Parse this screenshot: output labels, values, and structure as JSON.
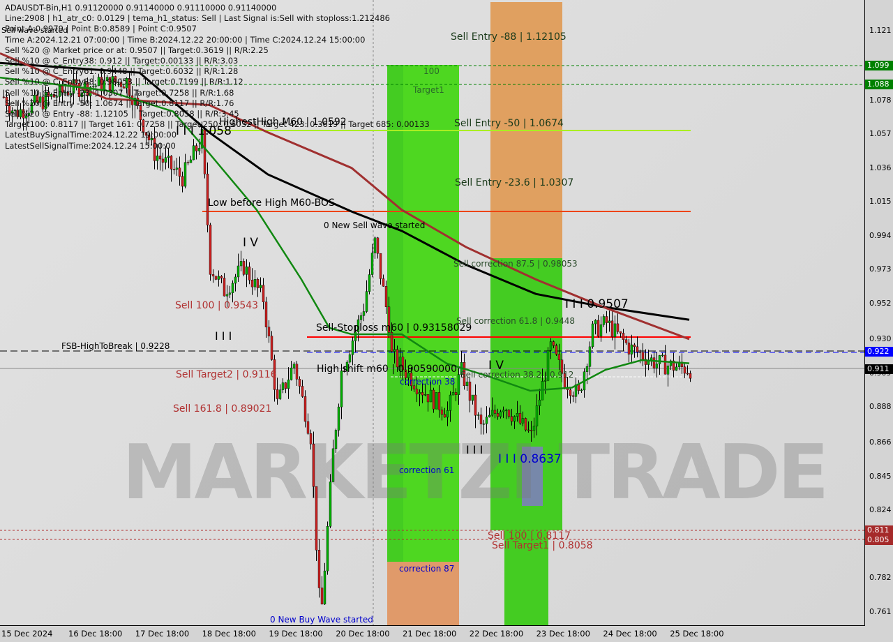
{
  "chart_data": {
    "type": "candlestick",
    "title": "ADAUSDT-Bin,H1  0.91120000 0.91140000 0.91110000 0.91140000",
    "symbol": "ADAUSDT-Bin",
    "timeframe": "H1",
    "ylim": [
      0.755,
      1.13
    ],
    "y_ticks": [
      "1.121",
      "1.078",
      "1.057",
      "1.036",
      "1.015",
      "0.994",
      "0.973",
      "0.952",
      "0.930",
      "0.909",
      "0.888",
      "0.866",
      "0.845",
      "0.824",
      "0.782",
      "0.761"
    ],
    "x_ticks": [
      "15 Dec 2024",
      "16 Dec 18:00",
      "17 Dec 18:00",
      "18 Dec 18:00",
      "19 Dec 18:00",
      "20 Dec 18:00",
      "21 Dec 18:00",
      "22 Dec 18:00",
      "23 Dec 18:00",
      "24 Dec 18:00",
      "25 Dec 18:00"
    ],
    "close": [
      [
        "2024-12-15 09:00",
        1.08
      ],
      [
        "2024-12-15 13:00",
        1.07
      ],
      [
        "2024-12-16 09:00",
        1.085
      ],
      [
        "2024-12-17 05:00",
        1.09
      ],
      [
        "2024-12-17 15:00",
        1.045
      ],
      [
        "2024-12-18 01:00",
        1.03
      ],
      [
        "2024-12-18 08:00",
        1.055
      ],
      [
        "2024-12-18 11:00",
        0.975
      ],
      [
        "2024-12-18 16:00",
        0.96
      ],
      [
        "2024-12-18 23:00",
        0.975
      ],
      [
        "2024-12-19 06:00",
        0.955
      ],
      [
        "2024-12-19 11:00",
        0.89
      ],
      [
        "2024-12-19 17:00",
        0.915
      ],
      [
        "2024-12-19 23:00",
        0.87
      ],
      [
        "2024-12-20 02:00",
        0.77
      ],
      [
        "2024-12-20 03:00",
        0.765
      ],
      [
        "2024-12-20 07:00",
        0.86
      ],
      [
        "2024-12-20 10:00",
        0.91
      ],
      [
        "2024-12-20 18:00",
        0.95
      ],
      [
        "2024-12-20 22:00",
        0.99
      ],
      [
        "2024-12-21 03:00",
        0.94
      ],
      [
        "2024-12-21 04:00",
        0.92
      ],
      [
        "2024-12-21 14:00",
        0.9
      ],
      [
        "2024-12-22 00:00",
        0.885
      ],
      [
        "2024-12-22 05:00",
        0.91
      ],
      [
        "2024-12-22 12:00",
        0.875
      ],
      [
        "2024-12-22 20:00",
        0.89
      ],
      [
        "2024-12-23 06:00",
        0.87
      ],
      [
        "2024-12-23 13:00",
        0.925
      ],
      [
        "2024-12-23 18:00",
        0.905
      ],
      [
        "2024-12-23 23:00",
        0.895
      ],
      [
        "2024-12-24 04:00",
        0.935
      ],
      [
        "2024-12-24 09:00",
        0.94
      ],
      [
        "2024-12-24 17:00",
        0.925
      ],
      [
        "2024-12-25 03:00",
        0.915
      ],
      [
        "2024-12-25 15:00",
        0.9114
      ]
    ],
    "ma_black": [
      [
        "2024-12-15 08:00",
        1.101
      ],
      [
        "2024-12-17 10:00",
        1.095
      ],
      [
        "2024-12-18 11:00",
        1.058
      ],
      [
        "2024-12-19 08:00",
        1.032
      ],
      [
        "2024-12-20 14:00",
        1.009
      ],
      [
        "2024-12-21 08:00",
        0.997
      ],
      [
        "2024-12-22 07:00",
        0.976
      ],
      [
        "2024-12-23 08:00",
        0.958
      ],
      [
        "2024-12-24 08:00",
        0.95
      ],
      [
        "2024-12-25 15:00",
        0.942
      ]
    ],
    "ma_brown": [
      [
        "2024-12-15 08:00",
        1.107
      ],
      [
        "2024-12-16 22:00",
        1.079
      ],
      [
        "2024-12-18 11:00",
        1.075
      ],
      [
        "2024-12-19 08:00",
        1.058
      ],
      [
        "2024-12-20 14:00",
        1.036
      ],
      [
        "2024-12-21 08:00",
        1.01
      ],
      [
        "2024-12-22 07:00",
        0.987
      ],
      [
        "2024-12-23 08:00",
        0.967
      ],
      [
        "2024-12-24 08:00",
        0.95
      ],
      [
        "2024-12-25 15:00",
        0.93
      ]
    ],
    "ma_green": [
      [
        "2024-12-15 08:00",
        1.092
      ],
      [
        "2024-12-16 22:00",
        1.084
      ],
      [
        "2024-12-17 22:00",
        1.071
      ],
      [
        "2024-12-18 11:00",
        1.045
      ],
      [
        "2024-12-19 04:00",
        1.01
      ],
      [
        "2024-12-19 20:00",
        0.967
      ],
      [
        "2024-12-20 06:00",
        0.937
      ],
      [
        "2024-12-20 14:00",
        0.933
      ],
      [
        "2024-12-21 08:00",
        0.933
      ],
      [
        "2024-12-22 00:00",
        0.915
      ],
      [
        "2024-12-22 15:00",
        0.907
      ],
      [
        "2024-12-23 06:00",
        0.898
      ],
      [
        "2024-12-23 21:00",
        0.9
      ],
      [
        "2024-12-24 09:00",
        0.911
      ],
      [
        "2024-12-24 22:00",
        0.917
      ],
      [
        "2024-12-25 15:00",
        0.915
      ]
    ],
    "price_badges": [
      {
        "text": "1.099",
        "color": "#008000"
      },
      {
        "text": "1.088",
        "color": "#008000"
      },
      {
        "text": "0.922",
        "color": "#0000ff"
      },
      {
        "text": "0.911",
        "color": "#000000"
      },
      {
        "text": "0.811",
        "color": "#a52a2a"
      },
      {
        "text": "0.805",
        "color": "#a52a2a"
      }
    ]
  },
  "info_lines": [
    "ADAUSDT-Bin,H1  0.91120000 0.91140000 0.91110000 0.91140000",
    "Line:2908 | h1_atr_c0: 0.0129 | tema_h1_status: Sell | Last Signal is:Sell with stoploss:1.212486",
    "Point A:0.9979 | Point B:0.8589 | Point C:0.9507",
    "Time A:2024.12.21 07:00:00 | Time B:2024.12.22 20:00:00 | Time C:2024.12.24 15:00:00",
    "Sell %20 @ Market price or at: 0.9507 || Target:0.3619 || R/R:2.25",
    "Sell %10 @ C_Entry38: 0.912 || Target:0.00133 || R/R:3.03",
    "Sell %10 @ C_Entry61: 0.9448 || Target:0.6032 || R/R:1.28",
    "Sell %10 @ C_Entry88: 0.98053 || Target:0.7199 || R/R:1.12",
    "Sell %10 @ Entry -23: 1.0307 || Target:0.7258 || R/R:1.68",
    "Sell %20 @ Entry -50: 1.0674 || Target:0.8117 || R/R:1.76",
    "Sell %20 @ Entry -88: 1.12105 || Target:0.8058 || R/R:3.45",
    "Target100: 0.8117 || Target 161: 0.7258 || Target 250: 0.6032 || Target 423: 0.3619 || Target 685: 0.00133",
    "LatestBuySignalTime:2024.12.22 19:00:00",
    "LatestSellSignalTime:2024.12.24 15:00:00"
  ],
  "labels": {
    "sell_wave": "Sell wave started",
    "sell_entry_88": "Sell Entry -88 | 1.12105",
    "l100": "100",
    "target1": "Target1",
    "sell_entry_50": "Sell Entry -50 | 1.0674",
    "highest_high": "HighestHigh   M60 | 1.0592",
    "iii_1058": "I I I 1.058",
    "sell_entry_23": "Sell Entry -23.6 | 1.0307",
    "low_before_high": "Low before High   M60-BOS",
    "new_sell_wave": "0 New Sell wave started",
    "iv1": "I V",
    "sell_corr_875": "Sell correction 87.5 | 0.98053",
    "sell_100": "Sell 100 | 0.9543",
    "iii_9507": "I I I 0.9507",
    "sell_corr_618": "Sell correction 61.8 | 0.9448",
    "stoploss": "Sell-Stoploss m60 | 0.93158029",
    "iii_a": "I I I",
    "fsb": "FSB-HighToBreak | 0.9228",
    "high_shift": "High shift m60 | 0.90590000",
    "iv2": "I V",
    "sell_corr_382": "Sell correction 38.2 | 0.912",
    "corr38": "correction 38",
    "sell_target2": "Sell Target2 | 0.9116",
    "sell_1618": "Sell 161.8 | 0.89021",
    "iii_b": "I I I",
    "iii_8637": "I I I 0.8637",
    "corr61": "correction 61",
    "sell_100b": "Sell 100 | 0.8117",
    "sell_target1": "Sell Target1 | 0.8058",
    "corr87": "correction 87",
    "new_buy_wave": "0 New Buy Wave started",
    "watermark": "MARKETZI TRADE"
  }
}
